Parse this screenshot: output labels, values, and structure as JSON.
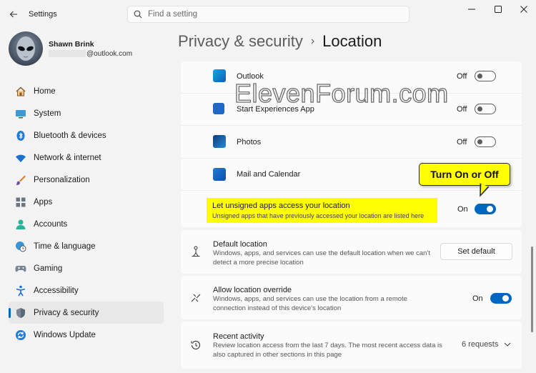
{
  "window": {
    "app_title": "Settings"
  },
  "search": {
    "placeholder": "Find a setting"
  },
  "profile": {
    "name": "Shawn Brink",
    "email_suffix": "@outlook.com"
  },
  "nav": {
    "items": [
      {
        "label": "Home",
        "icon": "home-icon",
        "active": false
      },
      {
        "label": "System",
        "icon": "monitor-icon",
        "active": false
      },
      {
        "label": "Bluetooth & devices",
        "icon": "bluetooth-icon",
        "active": false
      },
      {
        "label": "Network & internet",
        "icon": "wifi-icon",
        "active": false
      },
      {
        "label": "Personalization",
        "icon": "brush-icon",
        "active": false
      },
      {
        "label": "Apps",
        "icon": "apps-icon",
        "active": false
      },
      {
        "label": "Accounts",
        "icon": "person-icon",
        "active": false
      },
      {
        "label": "Time & language",
        "icon": "globe-clock-icon",
        "active": false
      },
      {
        "label": "Gaming",
        "icon": "gamepad-icon",
        "active": false
      },
      {
        "label": "Accessibility",
        "icon": "accessibility-icon",
        "active": false
      },
      {
        "label": "Privacy & security",
        "icon": "shield-icon",
        "active": true
      },
      {
        "label": "Windows Update",
        "icon": "update-icon",
        "active": false
      }
    ]
  },
  "breadcrumb": {
    "parent": "Privacy & security",
    "separator": "›",
    "current": "Location"
  },
  "apps": [
    {
      "name": "Outlook",
      "state": "Off",
      "on": false,
      "icon": "outlook-icon"
    },
    {
      "name": "Start Experiences App",
      "state": "Off",
      "on": false,
      "icon": "start-experiences-icon"
    },
    {
      "name": "Photos",
      "state": "Off",
      "on": false,
      "icon": "photos-icon"
    },
    {
      "name": "Mail and Calendar",
      "state": "",
      "on": false,
      "icon": "mail-calendar-icon"
    }
  ],
  "unsigned": {
    "title": "Let unsigned apps access your location",
    "subtitle": "Unsigned apps that have previously accessed your location are listed here",
    "state": "On",
    "on": true
  },
  "callout": {
    "text": "Turn On or Off"
  },
  "default_location": {
    "title": "Default location",
    "desc": "Windows, apps, and services can use the default location when we can't detect a more precise location",
    "button": "Set default"
  },
  "override": {
    "title": "Allow location override",
    "desc": "Windows, apps, and services can use the location from a remote connection instead of this device's location",
    "state": "On",
    "on": true
  },
  "recent": {
    "title": "Recent activity",
    "desc": "Review location access from the last 7 days. The most recent access data is also captured in other sections in this page",
    "count": "6 requests"
  },
  "watermark": {
    "text": "ElevenForum.com"
  },
  "colors": {
    "accent": "#0067c0",
    "highlight": "#ffff00"
  }
}
